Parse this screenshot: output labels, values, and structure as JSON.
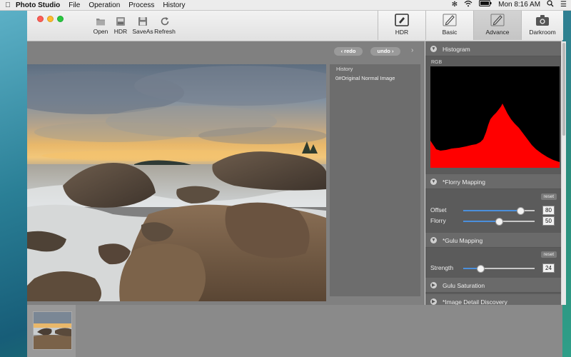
{
  "menubar": {
    "app_name": "Photo Studio",
    "items": [
      "File",
      "Operation",
      "Process",
      "History"
    ],
    "clock": "Mon 8:16 AM"
  },
  "toolbar": {
    "buttons": [
      {
        "label": "Open",
        "icon": "folder-icon"
      },
      {
        "label": "HDR",
        "icon": "hdr-icon"
      },
      {
        "label": "SaveAs",
        "icon": "save-icon"
      },
      {
        "label": "Refresh",
        "icon": "refresh-icon"
      }
    ],
    "modes": [
      {
        "label": "HDR",
        "icon": "hdr-mode-icon",
        "active": false
      },
      {
        "label": "Basic",
        "icon": "pencil-icon",
        "active": false
      },
      {
        "label": "Advance",
        "icon": "pencil-icon",
        "active": true
      },
      {
        "label": "Darkroom",
        "icon": "camera-icon",
        "active": false
      }
    ]
  },
  "history": {
    "redo_label": "redo",
    "undo_label": "undo",
    "title": "History",
    "items": [
      "0#Original Normal Image"
    ]
  },
  "panel": {
    "histogram": {
      "title": "Histogram",
      "channel": "RGB",
      "color": "#ff0000"
    },
    "florry": {
      "title": "*Florry Mapping",
      "reset_label": "reset",
      "sliders": [
        {
          "label": "Offset",
          "value": "80",
          "fraction": 0.8
        },
        {
          "label": "Florry",
          "value": "50",
          "fraction": 0.5
        }
      ]
    },
    "gulu": {
      "title": "*Gulu Mapping",
      "reset_label": "reset",
      "sliders": [
        {
          "label": "Strength",
          "value": "24",
          "fraction": 0.24
        }
      ]
    },
    "saturation": {
      "title": "Gulu Saturation"
    },
    "detail": {
      "title": "*Image Detail Discovery"
    }
  },
  "colors": {
    "accent": "#4b8fdc",
    "histogram": "#ff0000"
  }
}
